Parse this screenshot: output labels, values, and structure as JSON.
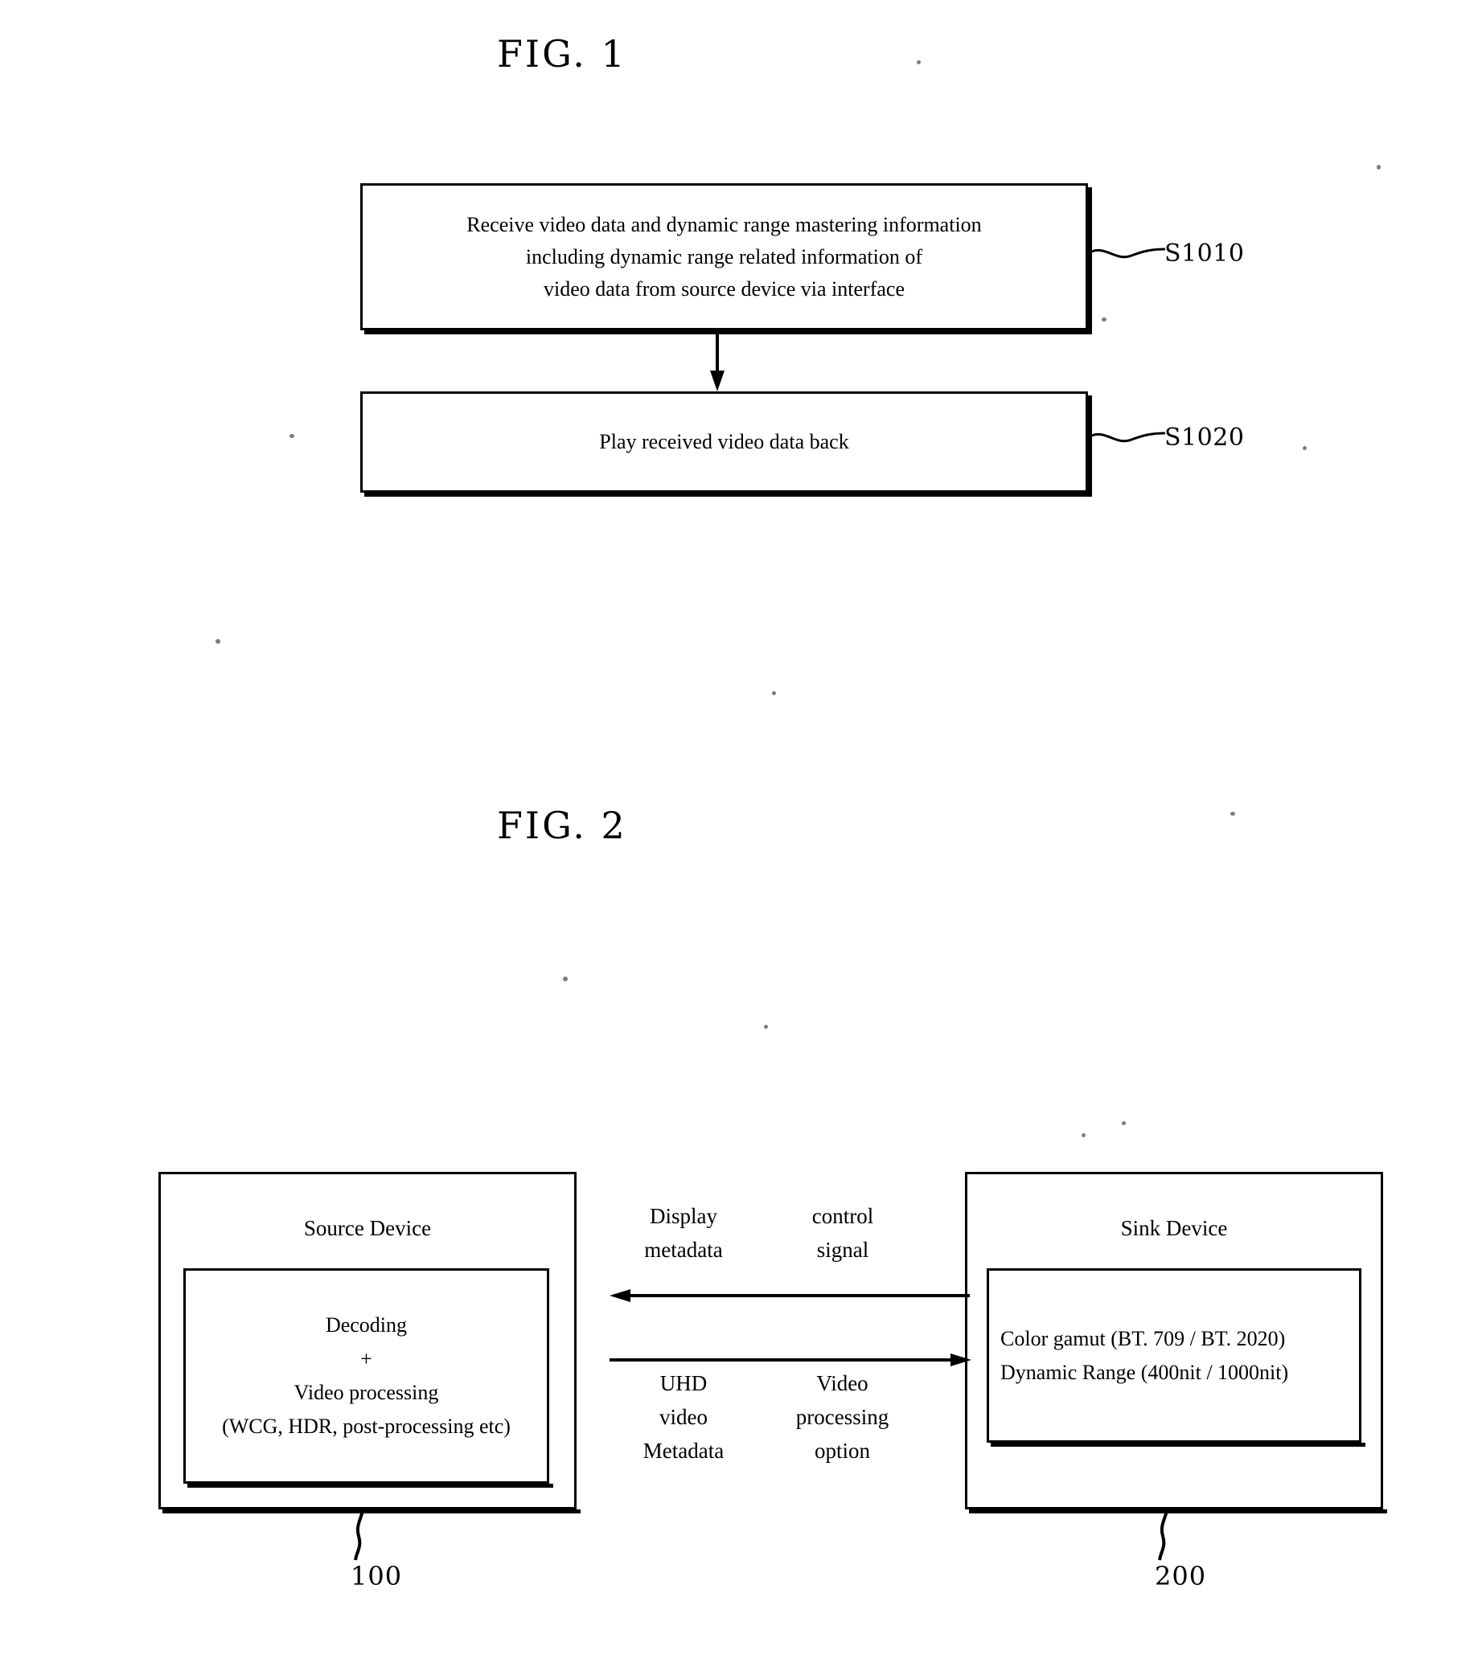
{
  "figures": [
    {
      "title": "FIG. 1",
      "steps": [
        {
          "ref": "S1010",
          "text": "Receive video data and dynamic range mastering information\nincluding dynamic range related information of\nvideo data from source device via interface"
        },
        {
          "ref": "S1020",
          "text": "Play received video data back"
        }
      ]
    },
    {
      "title": "FIG. 2",
      "source_device": {
        "title": "Source Device",
        "inner_text": "Decoding\n+\nVideo processing\n(WCG, HDR, post-processing etc)",
        "ref": "100"
      },
      "sink_device": {
        "title": "Sink Device",
        "inner_text": "Color gamut (BT. 709 / BT. 2020)\nDynamic Range (400nit / 1000nit)",
        "ref": "200"
      },
      "signals": {
        "upper_left_label": "Display\nmetadata",
        "upper_right_label": "control\nsignal",
        "lower_left_label": "UHD\nvideo\nMetadata",
        "lower_right_label": "Video\nprocessing\noption"
      }
    }
  ],
  "fig1": {
    "title": "FIG. 1",
    "step1_text": "Receive video data and dynamic range mastering information\nincluding dynamic range related information of\nvideo data from source device via interface",
    "step1_ref": "S1010",
    "step2_text": "Play received video data back",
    "step2_ref": "S1020"
  },
  "fig2": {
    "title": "FIG. 2",
    "source_title": "Source Device",
    "source_inner": "Decoding\n+\nVideo processing\n(WCG, HDR, post-processing etc)",
    "source_ref": "100",
    "sink_title": "Sink Device",
    "sink_inner": "Color gamut (BT. 709 / BT. 2020)\nDynamic Range (400nit / 1000nit)",
    "sink_ref": "200",
    "sig_display_metadata": "Display\nmetadata",
    "sig_control_signal": "control\nsignal",
    "sig_uhd_metadata": "UHD\nvideo\nMetadata",
    "sig_video_option": "Video\nprocessing\noption"
  },
  "colors": {
    "ink": "#000000",
    "paper": "#ffffff"
  }
}
